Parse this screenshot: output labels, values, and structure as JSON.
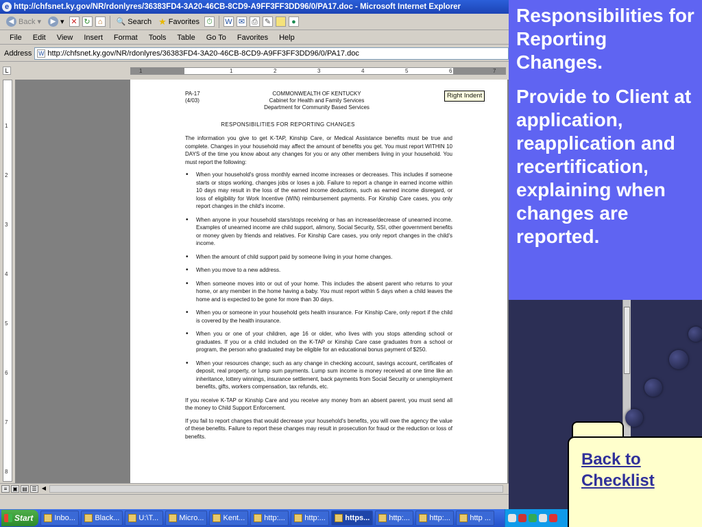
{
  "browser": {
    "title": "http://chfsnet.ky.gov/NR/rdonlyres/36383FD4-3A20-46CB-8CD9-A9FF3FF3DD96/0/PA17.doc - Microsoft Internet Explorer",
    "toolbar": {
      "back": "Back",
      "search": "Search",
      "favorites": "Favorites"
    },
    "menu": [
      "File",
      "Edit",
      "View",
      "Insert",
      "Format",
      "Tools",
      "Table",
      "Go To",
      "Favorites",
      "Help"
    ],
    "address_label": "Address",
    "address_url": "http://chfsnet.ky.gov/NR/rdonlyres/36383FD4-3A20-46CB-8CD9-A9FF3FF3DD96/0/PA17.doc"
  },
  "ruler": {
    "h_ticks": [
      "1",
      "1",
      "2",
      "3",
      "4",
      "5",
      "6",
      "7"
    ],
    "v_ticks": [
      "1",
      "2",
      "3",
      "4",
      "5",
      "6",
      "7",
      "8"
    ]
  },
  "tooltip": "Right Indent",
  "doc": {
    "form_id": "PA-17",
    "form_date": "(4/03)",
    "header_lines": [
      "COMMONWEALTH OF KENTUCKY",
      "Cabinet for Health and Family Services",
      "Department for Community Based Services"
    ],
    "title": "RESPONSIBILITIES FOR REPORTING CHANGES",
    "intro": "The information you give to get K-TAP, Kinship Care, or Medical Assistance benefits must be true and complete. Changes in your household may affect the amount of benefits you get. You must report WITHIN 10 DAYS of the time you know about any changes for you or any other members living in your household. You must report the following:",
    "bullets": [
      "When your household's gross monthly earned income increases or decreases. This includes if someone starts or stops working, changes jobs or loses a job. Failure to report a change in earned income within 10 days may result in the loss of the earned income deductions, such as earned income disregard, or loss of eligibility for Work Incentive (WIN) reimbursement payments. For Kinship Care cases, you only report changes in the child's income.",
      "When anyone in your household stars/stops receiving or has an increase/decrease of unearned income. Examples of unearned income are child support, alimony, Social Security, SSI, other government benefits or money given by friends and relatives. For Kinship Care cases, you only report changes in the child's income.",
      "When the amount of child support paid by someone living in your home changes.",
      "When you move to a new address.",
      "When someone moves into or out of your home. This includes the absent parent who returns to your home, or any member in the home having a baby. You must report within 5 days when a child leaves the home and is expected to be gone for more than 30 days.",
      "When you or someone in your household gets health insurance. For Kinship Care, only report if the child is covered by the health insurance.",
      "When you or one of your children, age 16 or older, who lives with you stops attending school or graduates. If you or a child included on the K-TAP or Kinship Care case graduates from a school or program, the person who graduated may be eligible for an educational bonus payment of $250.",
      "When your resources change; such as any change in checking account, savings account, certificates of deposit, real property, or lump sum payments. Lump sum income is money received at one time like an inheritance, lottery winnings, insurance settlement, back payments from Social Security or unemployment benefits, gifts, workers compensation, tax refunds, etc."
    ],
    "para_2": "If you receive K-TAP or Kinship Care and you receive any money from an absent parent, you must send all the money to Child Support Enforcement.",
    "para_3": "If you fail to report changes that would decrease your household's benefits, you will owe the agency the value of these benefits. Failure to report these changes may result in prosecution for fraud or the reduction or loss of benefits."
  },
  "taskbar": {
    "start": "Start",
    "tasks": [
      "Inbo...",
      "Black...",
      "U:\\T...",
      "Micro...",
      "Kent...",
      "http:...",
      "http:...",
      "https...",
      "http:...",
      "http:...",
      "http ..."
    ],
    "active_index": 7
  },
  "panel": {
    "heading": "Responsibilities for Reporting Changes.",
    "body": "Provide to Client at application, reapplication and recertification, explaining when changes are reported."
  },
  "back_link": {
    "line1": "Back to",
    "line2": "Checklist"
  },
  "colors": {
    "panel_bg": "#5f64f2",
    "folder_bg": "#ffffcc",
    "link": "#30309a",
    "xp_blue": "#2452c9"
  }
}
